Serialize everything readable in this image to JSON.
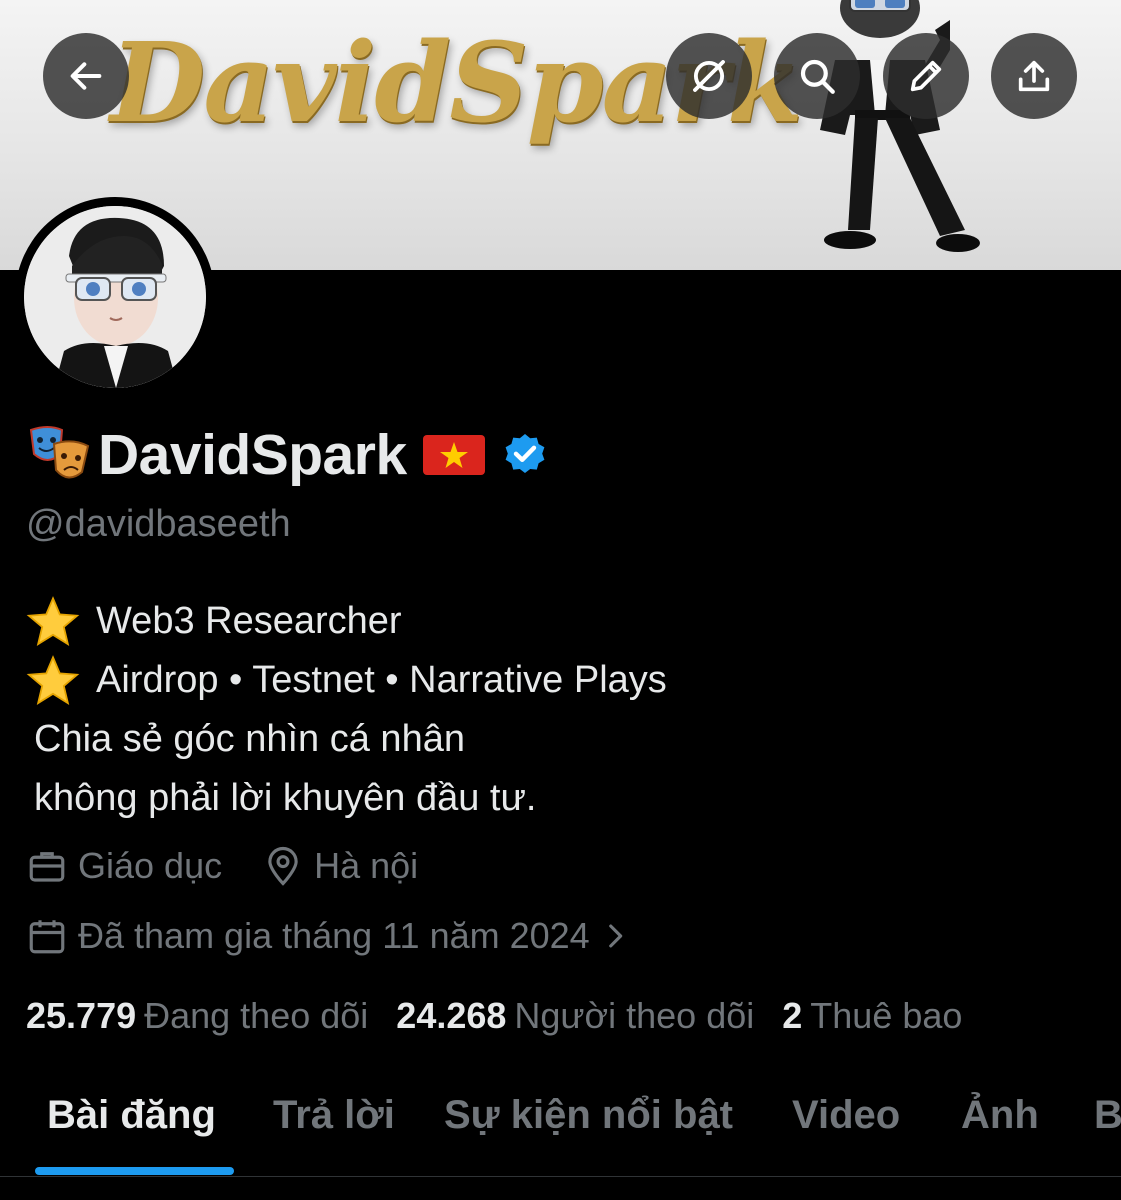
{
  "header": {
    "banner_logo_text": "DavidSpark",
    "buttons": [
      {
        "name": "back-button",
        "icon": "arrow-left-icon"
      },
      {
        "name": "grok-button",
        "icon": "grok-icon"
      },
      {
        "name": "search-button",
        "icon": "search-icon"
      },
      {
        "name": "edit-button",
        "icon": "pencil-icon"
      },
      {
        "name": "share-button",
        "icon": "share-upload-icon"
      }
    ]
  },
  "profile": {
    "name_prefix_emoji": "theater-masks-emoji",
    "display_name": "DavidSpark",
    "flag_emoji": "vietnam-flag",
    "verified_badge_color": "#1d9bf0",
    "handle": "@davidbaseeth",
    "bio": {
      "line1": "Web3 Researcher",
      "line2": "Airdrop • Testnet • Narrative Plays",
      "line3": "Chia sẻ góc nhìn cá nhân",
      "line4": "không phải lời khuyên đầu tư."
    },
    "category": "Giáo dục",
    "location": "Hà nội",
    "joined": "Đã tham gia tháng 11 năm 2024"
  },
  "stats": {
    "following_count": "25.779",
    "following_label": "Đang theo dõi",
    "followers_count": "24.268",
    "followers_label": "Người theo dõi",
    "subscriptions_count": "2",
    "subscriptions_label": "Thuê bao"
  },
  "tabs": [
    "Bài đăng",
    "Trả lời",
    "Sự kiện nổi bật",
    "Video",
    "Ảnh",
    "B"
  ],
  "colors": {
    "background": "#000000",
    "text_primary": "#e7e9ea",
    "text_secondary": "#71767b",
    "accent": "#1d9bf0"
  }
}
